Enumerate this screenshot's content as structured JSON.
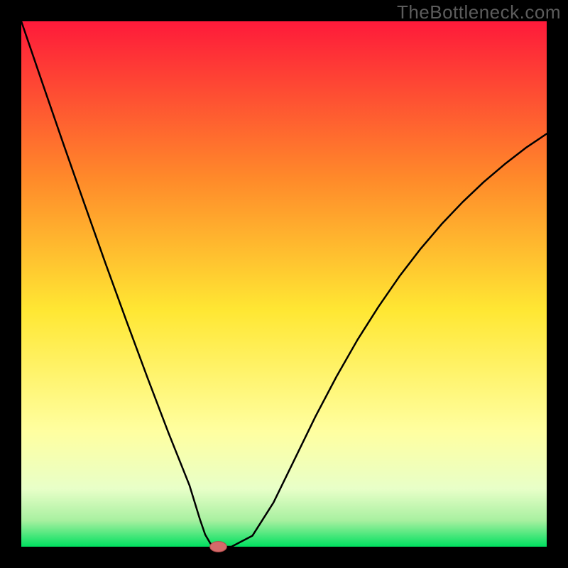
{
  "watermark": "TheBottleneck.com",
  "colors": {
    "border": "#000000",
    "curve": "#000000",
    "marker_fill": "#d46a6a",
    "marker_stroke": "#b44a4a",
    "gradient_top": "#fe1a3a",
    "gradient_mid_upper": "#ff8a2a",
    "gradient_mid": "#ffe733",
    "gradient_mid_lower": "#ffffa0",
    "gradient_band": "#e8ffc8",
    "gradient_bottom": "#00e060"
  },
  "chart_data": {
    "type": "line",
    "title": "",
    "xlabel": "",
    "ylabel": "",
    "xlim": [
      0,
      100
    ],
    "ylim": [
      0,
      100
    ],
    "series": [
      {
        "name": "bottleneck-curve",
        "x": [
          0,
          4,
          8,
          12,
          16,
          20,
          24,
          28,
          32,
          34,
          35,
          36,
          37,
          38,
          40,
          44,
          48,
          52,
          56,
          60,
          64,
          68,
          72,
          76,
          80,
          84,
          88,
          92,
          96,
          100
        ],
        "y": [
          100,
          88.3,
          76.7,
          65.3,
          54.0,
          43.0,
          32.2,
          21.7,
          11.7,
          5.2,
          2.3,
          0.6,
          0.0,
          0.0,
          0.0,
          2.1,
          8.4,
          16.6,
          24.8,
          32.4,
          39.4,
          45.7,
          51.5,
          56.7,
          61.4,
          65.6,
          69.4,
          72.8,
          75.9,
          78.6
        ]
      }
    ],
    "marker": {
      "x": 37.5,
      "y": 0,
      "rx": 1.6,
      "ry": 1.0
    },
    "background_gradient": {
      "orientation": "vertical",
      "stops": [
        {
          "offset": 0.0,
          "color": "#fe1a3a"
        },
        {
          "offset": 0.3,
          "color": "#ff8a2a"
        },
        {
          "offset": 0.55,
          "color": "#ffe733"
        },
        {
          "offset": 0.78,
          "color": "#ffffa0"
        },
        {
          "offset": 0.89,
          "color": "#e8ffc8"
        },
        {
          "offset": 0.95,
          "color": "#a8f0a0"
        },
        {
          "offset": 1.0,
          "color": "#00e060"
        }
      ]
    }
  }
}
